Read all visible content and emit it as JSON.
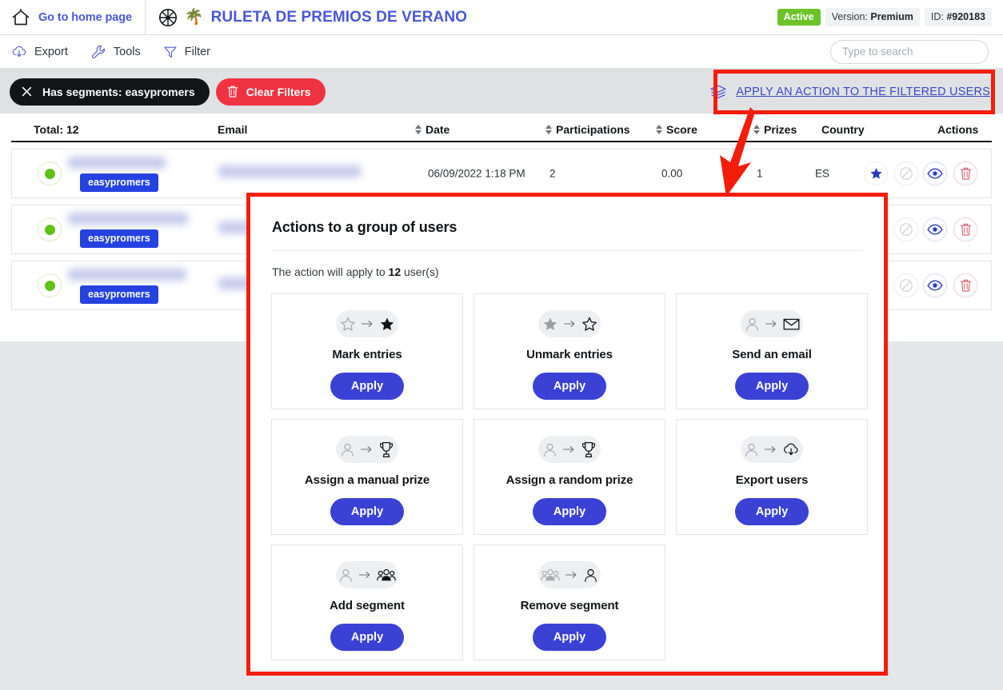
{
  "header": {
    "home_link": "Go to home page",
    "home_icon": "home-icon",
    "wheel_icon": "roulette-wheel-icon",
    "palm_icon": "🌴",
    "promotion_title": "RULETA DE PREMIOS DE VERANO",
    "status_badge": "Active",
    "version_label": "Version:",
    "version_value": "Premium",
    "id_label": "ID:",
    "id_value": "#920183"
  },
  "toolbar": {
    "items": [
      {
        "label": "Export",
        "icon": "cloud-download-icon"
      },
      {
        "label": "Tools",
        "icon": "wrench-icon"
      },
      {
        "label": "Filter",
        "icon": "funnel-icon"
      }
    ],
    "search_placeholder": "Type to search",
    "search_value": ""
  },
  "filter_bar": {
    "segment_chip": "Has segments: easypromers",
    "segment_chip_close_icon": "close-x-icon",
    "clear_filters": "Clear Filters",
    "clear_filters_icon": "trash-icon",
    "apply_action_link": "APPLY AN ACTION TO THE FILTERED USERS",
    "apply_action_icon": "layers-icon"
  },
  "table": {
    "columns": [
      {
        "label": "Total: 12",
        "sortable": false
      },
      {
        "label": "Email",
        "sortable": false
      },
      {
        "label": "Date",
        "sortable": true
      },
      {
        "label": "Participations",
        "sortable": true
      },
      {
        "label": "Score",
        "sortable": true
      },
      {
        "label": "Prizes",
        "sortable": true
      },
      {
        "label": "Country",
        "sortable": false
      },
      {
        "label": "Actions",
        "sortable": false
      }
    ],
    "rows": [
      {
        "status": "active",
        "segment": "easypromers",
        "date": "06/09/2022 1:18 PM",
        "participations": "2",
        "score": "0.00",
        "prizes": "1",
        "country": "ES",
        "actions": [
          "star-icon",
          "ban-icon",
          "eye-icon",
          "trash-icon"
        ]
      },
      {
        "status": "active",
        "segment": "easypromers",
        "date": "",
        "participations": "",
        "score": "",
        "prizes": "",
        "country": "",
        "actions": [
          "ban-icon",
          "eye-icon",
          "trash-icon"
        ]
      },
      {
        "status": "active",
        "segment": "easypromers",
        "date": "",
        "participations": "",
        "score": "",
        "prizes": "",
        "country": "",
        "actions": [
          "ban-icon",
          "eye-icon",
          "trash-icon"
        ]
      }
    ]
  },
  "modal": {
    "title": "Actions to a group of users",
    "subtitle_prefix": "The action will apply to ",
    "subtitle_count": "12",
    "subtitle_suffix": " user(s)",
    "apply_label": "Apply",
    "cards": [
      {
        "label": "Mark entries",
        "icon_from": "star-outline-icon",
        "icon_to": "star-filled-icon"
      },
      {
        "label": "Unmark entries",
        "icon_from": "star-filled-icon",
        "icon_to": "star-outline-icon"
      },
      {
        "label": "Send an email",
        "icon_from": "user-icon",
        "icon_to": "envelope-icon"
      },
      {
        "label": "Assign a manual prize",
        "icon_from": "user-icon",
        "icon_to": "trophy-icon"
      },
      {
        "label": "Assign a random prize",
        "icon_from": "user-icon",
        "icon_to": "trophy-icon"
      },
      {
        "label": "Export users",
        "icon_from": "user-icon",
        "icon_to": "cloud-download-icon"
      },
      {
        "label": "Add segment",
        "icon_from": "user-icon",
        "icon_to": "users-group-icon"
      },
      {
        "label": "Remove segment",
        "icon_from": "users-group-icon",
        "icon_to": "user-icon"
      }
    ]
  },
  "annotations": {
    "highlight_color": "#f41d0c",
    "boxes": [
      "apply-action-link-box",
      "modal-box"
    ],
    "arrow": "red-arrow-pointing-to-table"
  },
  "colors": {
    "brand_blue": "#4a57d6",
    "apply_button": "#3b41d4",
    "danger_red": "#ef3340",
    "status_green": "#6cc229",
    "segment_tag": "#2541e0"
  }
}
